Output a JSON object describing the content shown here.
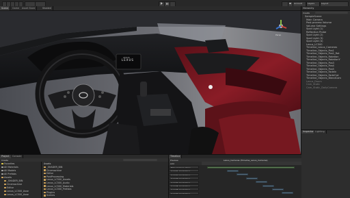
{
  "toolbar": {
    "center_text": "",
    "account": "Account",
    "layers": "Layers",
    "layout": "Layout"
  },
  "scene": {
    "tabs": [
      "Scene",
      "Game",
      "Asset Store"
    ],
    "shading": "Shaded",
    "gizmo_label": "Persp",
    "car_emblem_text": "LEXUS",
    "center_logo_text": "LEXUS"
  },
  "hierarchy": {
    "title": "Hierarchy",
    "create": "Create",
    "items": [
      {
        "label": "SampleScene",
        "indent": 0,
        "dim": false
      },
      {
        "label": "Main Camera",
        "indent": 1,
        "dim": false
      },
      {
        "label": "Post-process Volume",
        "indent": 1,
        "dim": false
      },
      {
        "label": "Volume Settings",
        "indent": 1,
        "dim": false
      },
      {
        "label": "Spot Light (1)",
        "indent": 1,
        "dim": false
      },
      {
        "label": "Reflection Probe",
        "indent": 1,
        "dim": false
      },
      {
        "label": "Spot Light (2)",
        "indent": 1,
        "dim": false
      },
      {
        "label": "Spot Light (3)",
        "indent": 1,
        "dim": false
      },
      {
        "label": "Spot Light (4)",
        "indent": 1,
        "dim": false
      },
      {
        "label": "Lexus_LC500",
        "indent": 1,
        "dim": false
      },
      {
        "label": "Timeline_Lexus_Cameras",
        "indent": 1,
        "dim": false
      },
      {
        "label": "Timeline_Objects_Pos1",
        "indent": 1,
        "dim": false
      },
      {
        "label": "Timeline_Objects_Pos2_Rot",
        "indent": 1,
        "dim": false
      },
      {
        "label": "Timeline_Objects_Rotation",
        "indent": 1,
        "dim": false
      },
      {
        "label": "Timeline_Objects_RotationY",
        "indent": 1,
        "dim": false
      },
      {
        "label": "Timeline_Objects_Pos3",
        "indent": 1,
        "dim": false
      },
      {
        "label": "Timeline_Objects_Pos4",
        "indent": 1,
        "dim": false
      },
      {
        "label": "Timeline_Objects_Pos5",
        "indent": 1,
        "dim": false
      },
      {
        "label": "Timeline_Objects_FadeIn",
        "indent": 1,
        "dim": false
      },
      {
        "label": "Timeline_Objects_FadeOut",
        "indent": 1,
        "dim": false
      },
      {
        "label": "Timeline_Objects_BlendCam",
        "indent": 1,
        "dim": false
      },
      {
        "label": "Lexus_Doors",
        "indent": 1,
        "dim": true
      },
      {
        "label": "Cam_Static",
        "indent": 1,
        "dim": true
      },
      {
        "label": "Cam_Static_DollyCamera",
        "indent": 1,
        "dim": true
      }
    ]
  },
  "inspector": {
    "tabs": [
      "Inspector",
      "Lighting"
    ]
  },
  "project": {
    "tabs": [
      "Project",
      "Console"
    ],
    "create": "Create",
    "tree": [
      {
        "label": "Favorites",
        "kind": "star"
      },
      {
        "label": "All Materials",
        "kind": "search"
      },
      {
        "label": "All Models",
        "kind": "search"
      },
      {
        "label": "All Prefabs",
        "kind": "search"
      },
      {
        "label": "Assets",
        "kind": "folder"
      },
      {
        "label": "_SHADER_BIN",
        "kind": "folder"
      },
      {
        "label": "Cinemachine",
        "kind": "folder"
      },
      {
        "label": "Editor",
        "kind": "folder"
      },
      {
        "label": "Lexus_LC500_Asse",
        "kind": "folder"
      },
      {
        "label": "Lexus_LC500_Asse",
        "kind": "folder"
      }
    ],
    "breadcrumb": "Assets",
    "files": [
      "_SHADER_BIN",
      "Cinemachine",
      "Editor",
      "PostProcessing",
      "Lexus_LC500_Assets",
      "Lexus_LC500_Audio",
      "Lexus_LC500_Materials",
      "Lexus_LC500_Prefabs",
      "Plugins",
      "Scenes"
    ]
  },
  "timeline": {
    "tab": "Timeline",
    "preview": "Preview",
    "title": "Lexus_Cameras (Timeline_Lexus_Cameras)",
    "add_label": "Add",
    "tracks": [
      "Main Camera (Cine",
      "Cam01 (Animator)",
      "Cam02 (Animator)",
      "Cam03 (Animator)",
      "Cam04 (Animator)",
      "Cam05 (Animator)",
      "Cam06 (Animator)",
      "Cam07 (Animator)"
    ]
  },
  "colors": {
    "leather_red": "#7a1a22",
    "dash_dark": "#1a1b1d",
    "editor_panel": "#2d2d2d",
    "timeline_clip": "#556c7d"
  }
}
